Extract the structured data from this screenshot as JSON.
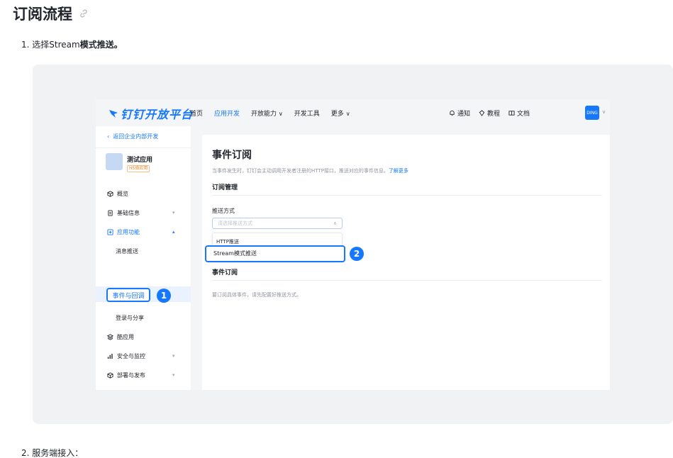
{
  "doc": {
    "title": "订阅流程",
    "step1_prefix": "1. 选择Stream",
    "step1_bold": "模式推送。",
    "step2": "2. 服务端接入："
  },
  "topbar": {
    "brand": "钉钉开放平台",
    "nav": [
      "首页",
      "应用开发",
      "开放能力",
      "开发工具",
      "更多"
    ],
    "right": [
      "通知",
      "教程",
      "文档"
    ],
    "avatar": "DING"
  },
  "sidebar": {
    "back": "返回企业内部开发",
    "app_name": "测试应用",
    "app_tag": "H5微应用",
    "items": [
      "概览",
      "基础信息",
      "应用功能",
      "酷应用",
      "安全与监控",
      "部署与发布"
    ],
    "subitems": [
      "消息推送",
      "事件与回调",
      "登录与分享"
    ]
  },
  "content": {
    "title": "事件订阅",
    "desc": "当事件发生时，钉钉会主动调用开发者注册的HTTP接口，推送对应的事件信息。",
    "desc_link": "了解更多",
    "section1": "订阅管理",
    "push_label": "推送方式",
    "select_placeholder": "请选择推送方式",
    "options": [
      "HTTP推送",
      "Stream模式推送"
    ],
    "section2": "事件订阅",
    "hint": "要订阅具体事件，请先配置好推送方式。"
  },
  "badges": [
    "1",
    "2"
  ],
  "colors": {
    "accent": "#1677ff",
    "frame_bg": "#f1f2f4"
  }
}
